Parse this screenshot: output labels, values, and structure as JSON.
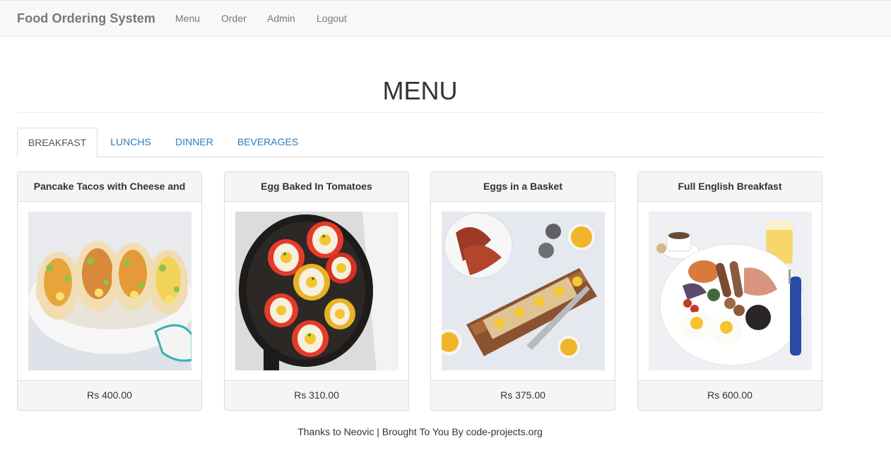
{
  "navbar": {
    "brand": "Food Ordering System",
    "links": [
      "Menu",
      "Order",
      "Admin",
      "Logout"
    ]
  },
  "page": {
    "title": "MENU"
  },
  "tabs": [
    {
      "label": "BREAKFAST",
      "active": true
    },
    {
      "label": "LUNCHS",
      "active": false
    },
    {
      "label": "DINNER",
      "active": false
    },
    {
      "label": "BEVERAGES",
      "active": false
    }
  ],
  "items": [
    {
      "name": "Pancake Tacos with Cheese and",
      "price": "Rs 400.00",
      "image": "pancake-tacos-photo"
    },
    {
      "name": "Egg Baked In Tomatoes",
      "price": "Rs 310.00",
      "image": "egg-baked-in-tomatoes-photo"
    },
    {
      "name": "Eggs in a Basket",
      "price": "Rs 375.00",
      "image": "eggs-in-a-basket-photo"
    },
    {
      "name": "Full English Breakfast",
      "price": "Rs 600.00",
      "image": "full-english-breakfast-photo"
    }
  ],
  "footer": {
    "text": "Thanks to Neovic | Brought To You By code-projects.org"
  }
}
